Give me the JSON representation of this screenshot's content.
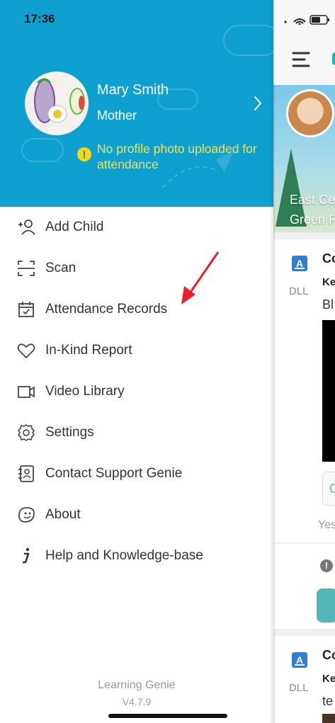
{
  "status_bar": {
    "time": "17:36"
  },
  "profile": {
    "name": "Mary Smith",
    "role": "Mother",
    "warning": "No profile photo uploaded for attendance"
  },
  "menu": [
    {
      "label": "Add Child",
      "icon": "add-child-icon"
    },
    {
      "label": "Scan",
      "icon": "scan-icon"
    },
    {
      "label": "Attendance Records",
      "icon": "calendar-check-icon"
    },
    {
      "label": "In-Kind Report",
      "icon": "heart-icon"
    },
    {
      "label": "Video Library",
      "icon": "video-camera-icon"
    },
    {
      "label": "Settings",
      "icon": "gear-icon"
    },
    {
      "label": "Contact Support Genie",
      "icon": "contact-support-icon"
    },
    {
      "label": "About",
      "icon": "genie-face-icon"
    },
    {
      "label": "Help and Knowledge-base",
      "icon": "info-italic-icon"
    }
  ],
  "footer": {
    "app_name": "Learning Genie",
    "version": "V4.7.9"
  },
  "background_content": {
    "banner_line1": "East Ce",
    "banner_line2": "Green F",
    "card1": {
      "badge": "A",
      "tag": "DLL",
      "title": "Co",
      "subtitle": "Ke",
      "text": "Bl",
      "pill_letter": "C",
      "date_fragment": "Yes"
    },
    "card2": {
      "badge": "A",
      "tag": "DLL",
      "title": "Co",
      "subtitle": "Ke",
      "text": "te"
    }
  },
  "colors": {
    "header_bg": "#0ea0cf",
    "warning_text": "#f6e04a",
    "arrow": "#e8202a",
    "accent_teal": "#52b5b8"
  }
}
